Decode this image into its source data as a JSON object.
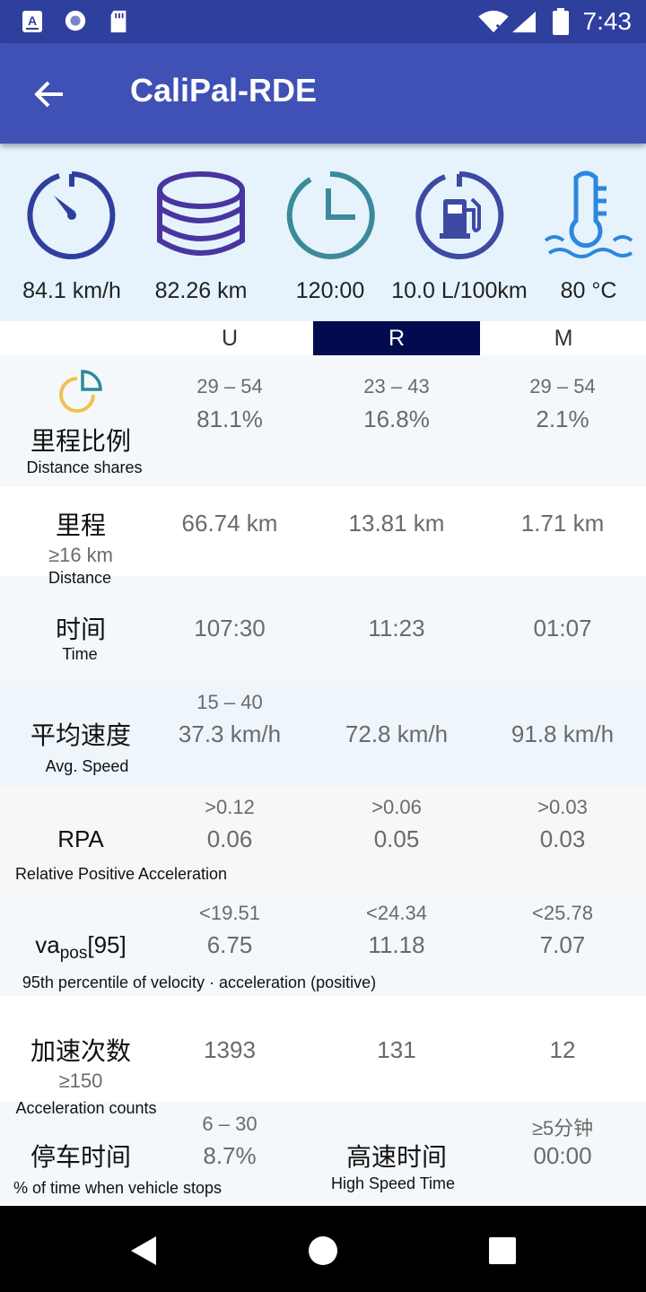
{
  "status_bar": {
    "time": "7:43",
    "icons": [
      "a-badge-icon",
      "record-icon",
      "sd-card-icon",
      "wifi-icon",
      "signal-icon",
      "battery-icon"
    ]
  },
  "app_bar": {
    "title": "CaliPal-RDE",
    "back_icon": "arrow-back-icon"
  },
  "summary": {
    "speed": "84.1 km/h",
    "distance": "82.26 km",
    "time": "120:00",
    "fuel": "10.0 L/100km",
    "temperature": "80 °C"
  },
  "columns": {
    "u": "U",
    "r": "R",
    "m": "M",
    "selected": "R"
  },
  "rows": {
    "share": {
      "label_zh": "里程比例",
      "label_en": "Distance shares",
      "u_range": "29 – 54",
      "u_value": "81.1%",
      "r_range": "23 – 43",
      "r_value": "16.8%",
      "m_range": "29 – 54",
      "m_value": "2.1%"
    },
    "distance": {
      "label_zh": "里程",
      "label_limit": "≥16 km",
      "label_en": "Distance",
      "u_value": "66.74 km",
      "r_value": "13.81 km",
      "m_value": "1.71 km"
    },
    "time": {
      "label_zh": "时间",
      "label_en": "Time",
      "u_value": "107:30",
      "r_value": "11:23",
      "m_value": "01:07"
    },
    "avg_speed": {
      "label_zh": "平均速度",
      "label_en": "Avg. Speed",
      "u_range": "15 – 40",
      "u_value": "37.3 km/h",
      "r_value": "72.8 km/h",
      "m_value": "91.8 km/h"
    },
    "rpa": {
      "label_main": "RPA",
      "label_en": "Relative Positive Acceleration",
      "u_range": ">0.12",
      "u_value": "0.06",
      "r_range": ">0.06",
      "r_value": "0.05",
      "m_range": ">0.03",
      "m_value": "0.03"
    },
    "vapos": {
      "label_main": "va",
      "label_sub": "pos",
      "label_suffix": "[95]",
      "label_en": "95th percentile of velocity · acceleration (positive)",
      "u_range": "<19.51",
      "u_value": "6.75",
      "r_range": "<24.34",
      "r_value": "11.18",
      "m_range": "<25.78",
      "m_value": "7.07"
    },
    "accel_counts": {
      "label_zh": "加速次数",
      "label_limit": "≥150",
      "label_en": "Acceleration counts",
      "u_value": "1393",
      "r_value": "131",
      "m_value": "12"
    },
    "stop_time": {
      "label_zh": "停车时间",
      "label_en": "% of time when vehicle stops",
      "range": "6 – 30",
      "value": "8.7%"
    },
    "high_speed": {
      "label_zh": "高速时间",
      "label_en": "High Speed Time",
      "range": "≥5分钟",
      "value": "00:00"
    }
  },
  "colors": {
    "status_bar": "#2f3f9e",
    "app_bar": "#3f51b5",
    "summary_bg": "#e6f3fc",
    "selected_col": "#020b4e"
  }
}
